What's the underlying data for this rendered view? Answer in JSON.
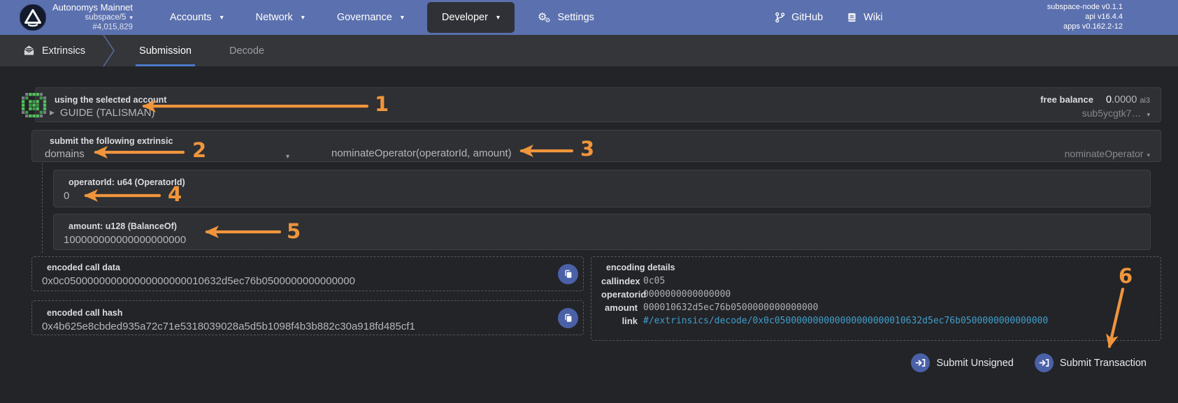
{
  "icons": {
    "caret": "▾"
  },
  "header": {
    "network": "Autonomys Mainnet",
    "chain": "subspace/5",
    "block": "#4,015,829",
    "nav": [
      {
        "label": "Accounts"
      },
      {
        "label": "Network"
      },
      {
        "label": "Governance"
      },
      {
        "label": "Developer"
      },
      {
        "label": "Settings"
      }
    ],
    "github": "GitHub",
    "wiki": "Wiki",
    "versions": [
      "subspace-node v0.1.1",
      "api v16.4.4",
      "apps v0.162.2-12"
    ]
  },
  "tabs": {
    "section": "Extrinsics",
    "items": [
      {
        "label": "Submission",
        "active": true
      },
      {
        "label": "Decode",
        "active": false
      }
    ]
  },
  "account": {
    "label": "using the selected account",
    "expander": "▶",
    "name": "GUIDE (TALISMAN)",
    "free_balance_label": "free balance",
    "balance_whole": "0",
    "balance_frac": ".0000",
    "balance_unit": "ai3",
    "address": "sub5ycgtk7…"
  },
  "extrinsic": {
    "label": "submit the following extrinsic",
    "pallet": "domains",
    "method_signature": "nominateOperator(operatorId, amount)",
    "method_name": "nominateOperator"
  },
  "params": [
    {
      "label": "operatorId: u64 (OperatorId)",
      "value": "0"
    },
    {
      "label": "amount: u128 (BalanceOf)",
      "value": "100000000000000000000"
    }
  ],
  "encoded": {
    "call_data_label": "encoded call data",
    "call_data": "0x0c050000000000000000000010632d5ec76b0500000000000000",
    "call_hash_label": "encoded call hash",
    "call_hash": "0x4b625e8cbded935a72c71e5318039028a5d5b1098f4b3b882c30a918fd485cf1"
  },
  "encoding_details": {
    "title": "encoding details",
    "rows": [
      {
        "label": "callindex",
        "value": "0c05"
      },
      {
        "label": "operatorid",
        "value": "0000000000000000"
      },
      {
        "label": "amount",
        "value": "000010632d5ec76b0500000000000000"
      },
      {
        "label": "link",
        "value": "#/extrinsics/decode/0x0c050000000000000000000010632d5ec76b0500000000000000"
      }
    ]
  },
  "actions": {
    "submit_unsigned": "Submit Unsigned",
    "submit_transaction": "Submit Transaction"
  },
  "annotations": [
    {
      "label": "1"
    },
    {
      "label": "2"
    },
    {
      "label": "3"
    },
    {
      "label": "4"
    },
    {
      "label": "5"
    },
    {
      "label": "6"
    }
  ],
  "colors": {
    "header_bg": "#5b70ae",
    "active_nav_bg": "#2f3136",
    "tab_underline": "#4b79c9",
    "accent_button": "#4a61a8",
    "link": "#3f9fcc",
    "annotation": "#f0953c",
    "identicon_green": "#52c15c"
  }
}
